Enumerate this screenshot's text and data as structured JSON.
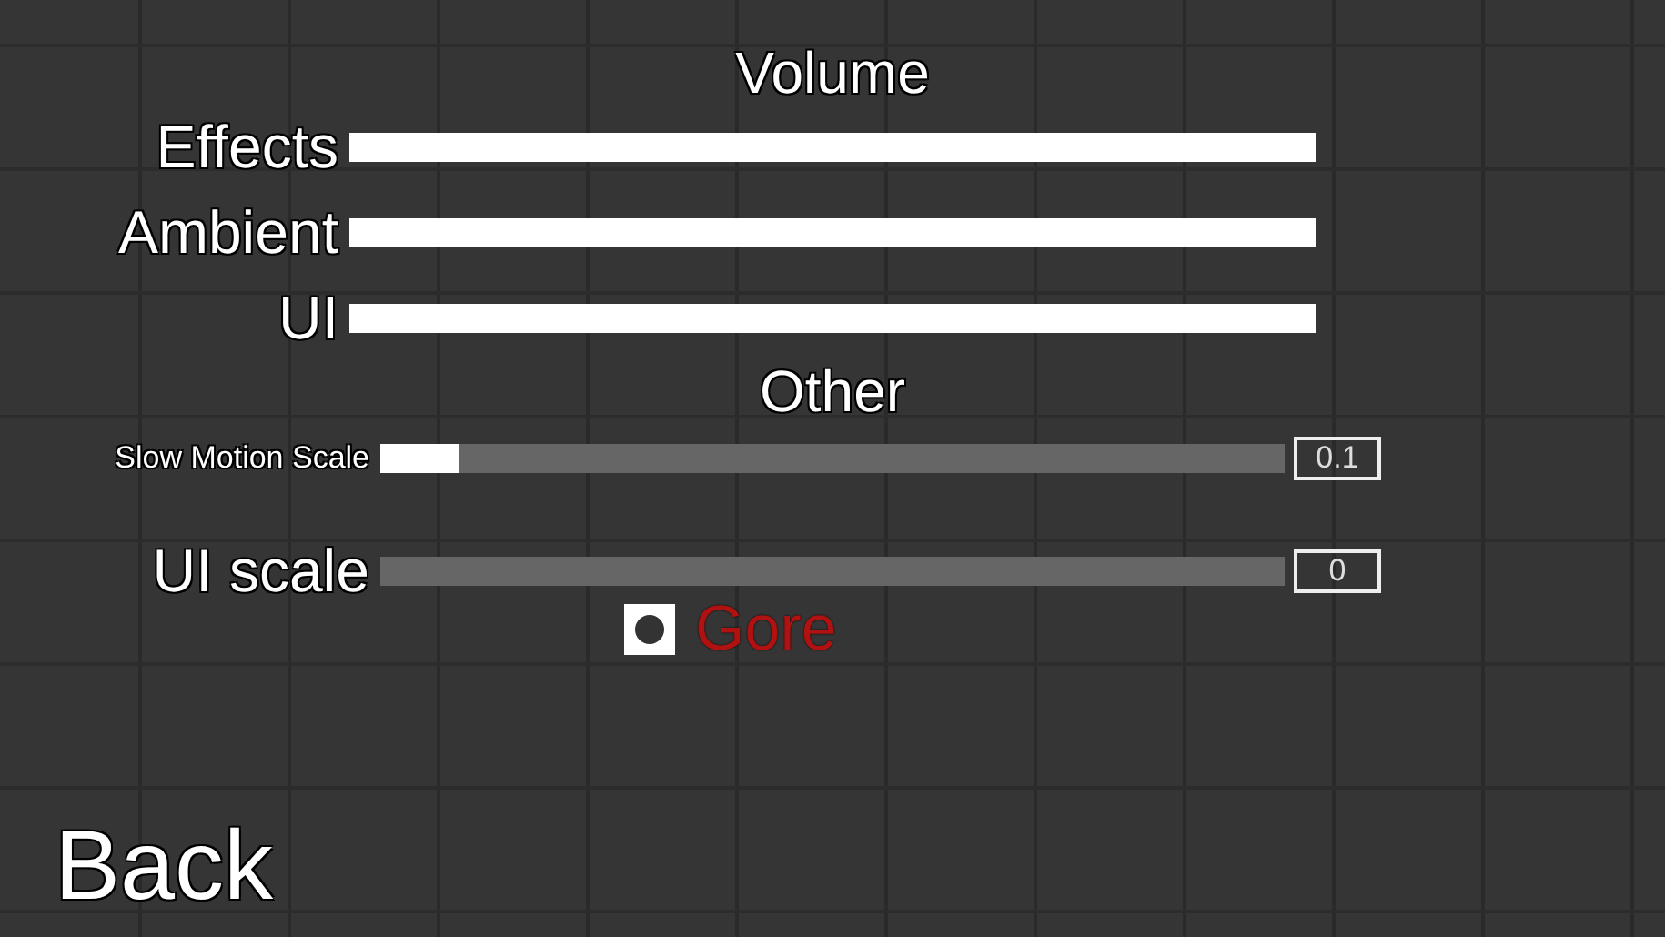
{
  "volume": {
    "title": "Volume",
    "sliders": [
      {
        "label": "Effects",
        "level": 1
      },
      {
        "label": "Ambient",
        "level": 1
      },
      {
        "label": "UI",
        "level": 1
      }
    ]
  },
  "other": {
    "title": "Other",
    "sliders": [
      {
        "label": "Slow Motion Scale",
        "level": 0.087,
        "value": "0.1"
      },
      {
        "label": "UI scale",
        "level": 0,
        "value": "0"
      }
    ],
    "gore": {
      "label": "Gore",
      "checked": true
    }
  },
  "back": "Back"
}
